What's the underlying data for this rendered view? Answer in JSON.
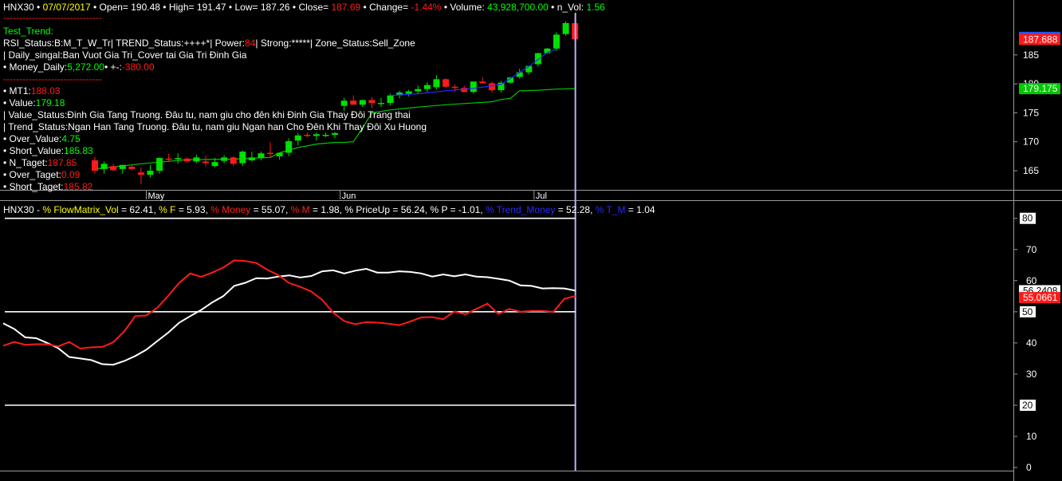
{
  "price_header": {
    "symbol": "HNX30",
    "date": "07/07/2017",
    "open_label": "Open=",
    "open": "190.48",
    "high_label": "High=",
    "high": "191.47",
    "low_label": "Low=",
    "low": "187.26",
    "close_label": "Close=",
    "close": "187.69",
    "change_label": "Change=",
    "change": "-1.44%",
    "volume_label": "Volume:",
    "volume": "43,928,700.00",
    "nvol_label": "n_Vol:",
    "nvol": "1.56"
  },
  "indicator_text": {
    "separator": "-------------------------------",
    "test_trend": "Test_Trend:",
    "rsi_status_a": "RSI_Status:B:M_T_W_Tr| TREND_Status:++++*| Power:",
    "rsi_power": "84",
    "rsi_status_b": "| Strong:*****| Zone_Status:Sell_Zone",
    "daily_signal": "| Daily_singal:Ban Vuot Gia Tri_Cover tai Gia Tri Đinh Gia",
    "money_daily_label": "• Money_Daily:",
    "money_daily": "5,272.00",
    "money_change_label": "• +-:",
    "money_change": "-380.00",
    "mt1_label": "• MT1:",
    "mt1": "188.03",
    "value_label": "• Value:",
    "value": "179.18",
    "value_status": "| Value_Status:Đinh Gia Tang Truong. Đâu tu, nam giu cho đên khi Đinh Gia Thay Đôi Trang thai",
    "trend_status": "| Trend_Status:Ngan Han Tang Truong. Đâu tu, nam giu Ngan han Cho Đên Khi Thay Đôi Xu Huong",
    "over_value_label": "• Over_Value:",
    "over_value": "4.75",
    "short_value_label": "• Short_Value:",
    "short_value": "185.83",
    "n_taget_label": "• N_Taget:",
    "n_taget": "187.85",
    "over_taget_label": "• Over_Taget:",
    "over_taget": "0.09",
    "short_taget_label": "• Short_Taget:",
    "short_taget": "185.82"
  },
  "lower_header": {
    "symbol": "HNX30 - ",
    "flow_label": "% FlowMatrix_Vol",
    "flow": "= 62.41,",
    "f_label": "% F",
    "f": "= 5.93,",
    "money_label": "% Money",
    "money": "= 55.07,",
    "m_label": "% M",
    "m": "= 1.98,",
    "priceup_label": "% PriceUp",
    "priceup": "= 56.24,",
    "p_label": "% P",
    "p": "= -1.01,",
    "trend_money_label": "% Trend_Money",
    "trend_money": "= 52.28,",
    "tm_label": "% T_M",
    "tm": "= 1.04"
  },
  "colors": {
    "background": "#000000",
    "up_candle": "#00e000",
    "down_candle": "#ff1a1a",
    "value_line": "#00c800",
    "ma_line": "#2a2aff",
    "cursor": "#b4b4ff",
    "white_line": "#ffffff",
    "red_line": "#ff1a1a"
  },
  "chart_data": [
    {
      "type": "candlestick",
      "title": "HNX30",
      "x_tick_labels": [
        "May",
        "Jun",
        "Jul"
      ],
      "y_ticks": [
        165,
        170,
        175,
        180,
        185
      ],
      "ylim": [
        161.7,
        192.0
      ],
      "price_badges": [
        {
          "label": "188.029",
          "color": "#2255ff"
        },
        {
          "label": "187.688",
          "color": "#ff1a1a"
        },
        {
          "label": "179.175",
          "color": "#00c800"
        }
      ],
      "candles": [
        {
          "o": 166.8,
          "h": 167.4,
          "l": 164.5,
          "c": 165.0
        },
        {
          "o": 165.3,
          "h": 166.6,
          "l": 164.5,
          "c": 166.2
        },
        {
          "o": 165.8,
          "h": 166.2,
          "l": 164.9,
          "c": 165.1
        },
        {
          "o": 165.3,
          "h": 166.0,
          "l": 164.5,
          "c": 166.0
        },
        {
          "o": 165.7,
          "h": 166.1,
          "l": 165.1,
          "c": 165.3
        },
        {
          "o": 164.7,
          "h": 165.6,
          "l": 162.7,
          "c": 164.3
        },
        {
          "o": 164.3,
          "h": 166.0,
          "l": 163.8,
          "c": 165.0
        },
        {
          "o": 165.0,
          "h": 167.3,
          "l": 164.5,
          "c": 167.2
        },
        {
          "o": 167.1,
          "h": 167.9,
          "l": 166.7,
          "c": 166.9
        },
        {
          "o": 167.0,
          "h": 168.0,
          "l": 166.2,
          "c": 167.2
        },
        {
          "o": 167.1,
          "h": 167.3,
          "l": 166.4,
          "c": 166.6
        },
        {
          "o": 166.6,
          "h": 167.8,
          "l": 166.3,
          "c": 167.3
        },
        {
          "o": 166.6,
          "h": 167.6,
          "l": 165.8,
          "c": 166.3
        },
        {
          "o": 165.8,
          "h": 167.2,
          "l": 165.6,
          "c": 166.5
        },
        {
          "o": 166.7,
          "h": 167.7,
          "l": 166.3,
          "c": 167.3
        },
        {
          "o": 167.3,
          "h": 167.5,
          "l": 165.8,
          "c": 166.2
        },
        {
          "o": 166.3,
          "h": 168.5,
          "l": 165.8,
          "c": 168.3
        },
        {
          "o": 166.8,
          "h": 168.3,
          "l": 166.6,
          "c": 167.3
        },
        {
          "o": 167.2,
          "h": 168.3,
          "l": 166.8,
          "c": 168.0
        },
        {
          "o": 168.1,
          "h": 169.9,
          "l": 167.2,
          "c": 168.0
        },
        {
          "o": 167.5,
          "h": 168.1,
          "l": 166.9,
          "c": 168.1
        },
        {
          "o": 168.1,
          "h": 170.6,
          "l": 167.5,
          "c": 170.1
        },
        {
          "o": 170.2,
          "h": 171.5,
          "l": 169.4,
          "c": 171.1
        },
        {
          "o": 171.2,
          "h": 171.6,
          "l": 170.8,
          "c": 171.0
        },
        {
          "o": 171.0,
          "h": 171.6,
          "l": 170.2,
          "c": 171.3
        },
        {
          "o": 171.2,
          "h": 171.6,
          "l": 170.8,
          "c": 171.2
        },
        {
          "o": 171.2,
          "h": 171.7,
          "l": 170.6,
          "c": 171.5
        },
        {
          "o": 176.2,
          "h": 177.6,
          "l": 175.3,
          "c": 177.1
        },
        {
          "o": 177.1,
          "h": 178.0,
          "l": 176.5,
          "c": 176.4
        },
        {
          "o": 176.4,
          "h": 177.3,
          "l": 176.0,
          "c": 177.2
        },
        {
          "o": 177.2,
          "h": 177.7,
          "l": 175.8,
          "c": 176.7
        },
        {
          "o": 176.7,
          "h": 177.6,
          "l": 176.0,
          "c": 176.7
        },
        {
          "o": 176.7,
          "h": 178.3,
          "l": 176.3,
          "c": 178.0
        },
        {
          "o": 178.0,
          "h": 178.8,
          "l": 177.5,
          "c": 178.5
        },
        {
          "o": 178.3,
          "h": 179.0,
          "l": 177.8,
          "c": 178.7
        },
        {
          "o": 178.7,
          "h": 179.7,
          "l": 178.2,
          "c": 179.1
        },
        {
          "o": 179.1,
          "h": 180.3,
          "l": 178.6,
          "c": 179.8
        },
        {
          "o": 179.4,
          "h": 181.5,
          "l": 179.0,
          "c": 180.8
        },
        {
          "o": 180.8,
          "h": 181.0,
          "l": 179.3,
          "c": 179.5
        },
        {
          "o": 179.5,
          "h": 179.9,
          "l": 178.6,
          "c": 179.3
        },
        {
          "o": 179.3,
          "h": 179.7,
          "l": 178.6,
          "c": 178.6
        },
        {
          "o": 178.6,
          "h": 180.4,
          "l": 178.3,
          "c": 180.4
        },
        {
          "o": 180.4,
          "h": 181.1,
          "l": 180.2,
          "c": 180.1
        },
        {
          "o": 180.1,
          "h": 180.4,
          "l": 178.5,
          "c": 178.9
        },
        {
          "o": 178.9,
          "h": 180.5,
          "l": 178.5,
          "c": 180.2
        },
        {
          "o": 180.2,
          "h": 181.2,
          "l": 180.0,
          "c": 181.1
        },
        {
          "o": 181.2,
          "h": 182.6,
          "l": 180.9,
          "c": 182.0
        },
        {
          "o": 182.0,
          "h": 183.0,
          "l": 181.6,
          "c": 183.1
        },
        {
          "o": 183.4,
          "h": 185.4,
          "l": 183.0,
          "c": 185.3
        },
        {
          "o": 185.3,
          "h": 186.2,
          "l": 185.2,
          "c": 186.1
        },
        {
          "o": 186.1,
          "h": 188.9,
          "l": 185.7,
          "c": 188.5
        },
        {
          "o": 188.6,
          "h": 190.8,
          "l": 188.3,
          "c": 190.5
        },
        {
          "o": 190.48,
          "h": 191.47,
          "l": 187.26,
          "c": 187.69
        }
      ],
      "value_line": [
        {
          "i": 0,
          "v": 165.3
        },
        {
          "i": 5,
          "v": 166.2
        },
        {
          "i": 10,
          "v": 166.9
        },
        {
          "i": 15,
          "v": 167.0
        },
        {
          "i": 19,
          "v": 167.3
        },
        {
          "i": 20,
          "v": 168.1
        },
        {
          "i": 22,
          "v": 169.0
        },
        {
          "i": 24,
          "v": 169.6
        },
        {
          "i": 26,
          "v": 169.9
        },
        {
          "i": 27,
          "v": 169.9
        },
        {
          "i": 28,
          "v": 170.0
        },
        {
          "i": 29,
          "v": 172.4
        },
        {
          "i": 30,
          "v": 175.0
        },
        {
          "i": 32,
          "v": 175.5
        },
        {
          "i": 35,
          "v": 176.0
        },
        {
          "i": 38,
          "v": 176.4
        },
        {
          "i": 40,
          "v": 176.6
        },
        {
          "i": 43,
          "v": 176.9
        },
        {
          "i": 44,
          "v": 177.3
        },
        {
          "i": 45,
          "v": 177.5
        },
        {
          "i": 46,
          "v": 178.8
        },
        {
          "i": 48,
          "v": 178.9
        },
        {
          "i": 50,
          "v": 179.1
        },
        {
          "i": 52,
          "v": 179.18
        }
      ],
      "ma_line": [
        {
          "i": 32,
          "v": 178.0
        },
        {
          "i": 35,
          "v": 178.3
        },
        {
          "i": 38,
          "v": 178.8
        },
        {
          "i": 41,
          "v": 179.2
        },
        {
          "i": 44,
          "v": 179.9
        },
        {
          "i": 47,
          "v": 183.0
        },
        {
          "i": 49,
          "v": 185.4
        },
        {
          "i": 50,
          "v": 186.0
        }
      ]
    },
    {
      "type": "line",
      "title": "HNX30 - % FlowMatrix_Vol",
      "y_ticks": [
        0,
        10,
        20,
        30,
        40,
        50,
        60,
        70,
        80
      ],
      "boxed_ticks": [
        20,
        50,
        80
      ],
      "ylim": [
        -1,
        83
      ],
      "horizontal_levels": [
        20,
        50,
        80
      ],
      "value_badges": [
        {
          "label": "56.2408",
          "color": "#ffffff"
        },
        {
          "label": "55.0661",
          "color": "#ff1a1a"
        }
      ],
      "series": [
        {
          "name": "% FlowMatrix_Vol",
          "color": "#ffffff",
          "values": [
            46.3,
            44.5,
            41.8,
            41.5,
            40.0,
            38.3,
            35.5,
            35.0,
            34.5,
            33.2,
            33.0,
            34.2,
            35.8,
            37.8,
            40.6,
            43.3,
            46.5,
            48.6,
            50.6,
            53.0,
            55.0,
            58.3,
            59.3,
            60.8,
            60.7,
            61.3,
            61.7,
            61.0,
            61.5,
            63.0,
            63.3,
            62.3,
            63.2,
            63.8,
            62.6,
            62.6,
            63.0,
            62.8,
            62.3,
            61.3,
            62.0,
            61.4,
            62.0,
            61.3,
            61.1,
            60.6,
            60.0,
            58.5,
            58.3,
            57.5,
            57.6,
            57.5,
            56.8
          ]
        },
        {
          "name": "% Money",
          "color": "#ff1a1a",
          "values": [
            39.1,
            40.3,
            39.4,
            39.6,
            39.6,
            38.9,
            40.3,
            38.2,
            38.6,
            38.7,
            40.2,
            43.7,
            48.6,
            48.8,
            51.3,
            55.1,
            59.3,
            62.3,
            61.2,
            62.6,
            64.2,
            66.5,
            66.3,
            65.7,
            63.5,
            61.8,
            59.2,
            58.0,
            56.5,
            53.8,
            49.7,
            47.0,
            46.0,
            46.7,
            46.5,
            46.2,
            45.7,
            46.9,
            48.2,
            48.3,
            47.6,
            50.1,
            49.2,
            50.9,
            52.6,
            49.3,
            50.9,
            50.0,
            50.3,
            50.3,
            50.0,
            54.2,
            55.07
          ]
        }
      ]
    }
  ]
}
